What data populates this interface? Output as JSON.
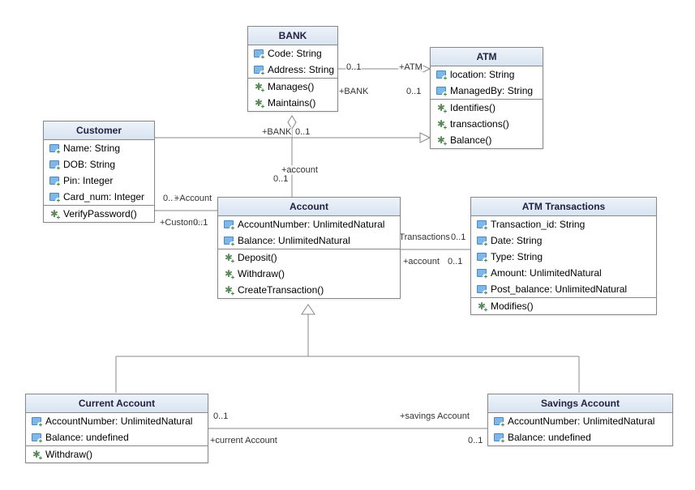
{
  "classes": {
    "bank": {
      "title": "BANK",
      "attrs": [
        "Code: String",
        "Address: String"
      ],
      "ops": [
        "Manages()",
        "Maintains()"
      ]
    },
    "atm": {
      "title": "ATM",
      "attrs": [
        "location: String",
        "ManagedBy: String"
      ],
      "ops": [
        "Identifies()",
        "transactions()",
        "Balance()"
      ]
    },
    "customer": {
      "title": "Customer",
      "attrs": [
        "Name: String",
        "DOB: String",
        "Pin: Integer",
        "Card_num: Integer"
      ],
      "ops": [
        "VerifyPassword()"
      ]
    },
    "account": {
      "title": "Account",
      "attrs": [
        "AccountNumber: UnlimitedNatural",
        "Balance: UnlimitedNatural"
      ],
      "ops": [
        "Deposit()",
        "Withdraw()",
        "CreateTransaction()"
      ]
    },
    "atmTrans": {
      "title": "ATM Transactions",
      "attrs": [
        "Transaction_id: String",
        "Date: String",
        "Type: String",
        "Amount: UnlimitedNatural",
        "Post_balance: UnlimitedNatural"
      ],
      "ops": [
        "Modifies()"
      ]
    },
    "current": {
      "title": "Current Account",
      "attrs": [
        "AccountNumber: UnlimitedNatural",
        "Balance: undefined"
      ],
      "ops": [
        "Withdraw()"
      ]
    },
    "savings": {
      "title": "Savings Account",
      "attrs": [
        "AccountNumber: UnlimitedNatural",
        "Balance: undefined"
      ],
      "ops": []
    }
  },
  "labels": {
    "bankAtm_mult1": "0..1",
    "bankAtm_role1": "+ATM",
    "bankAtm_role2": "+BANK",
    "bankAtm_mult2": "0..1",
    "bankAcc_role1": "+BANK",
    "bankAcc_mult1": "0..1",
    "bankAcc_role2": "+account",
    "bankAcc_mult2": "0..1",
    "custAcc_mult1": "0..1",
    "custAcc_role1": "+Account",
    "custAcc_role2": "+Customer",
    "custAcc_mult2": "0..1",
    "accTrans_role1": "+aTM Transactions",
    "accTrans_mult1": "0..1",
    "accTrans_role2": "+account",
    "accTrans_mult2": "0..1",
    "curSav_mult1": "0..1",
    "curSav_role1": "+savings Account",
    "curSav_role2": "+current Account",
    "curSav_mult2": "0..1"
  }
}
